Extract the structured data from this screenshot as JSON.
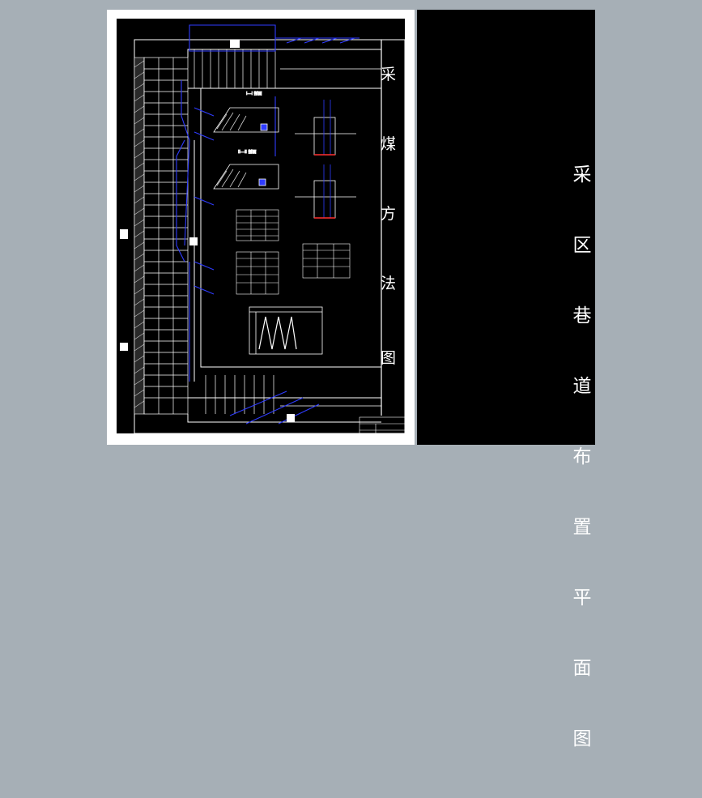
{
  "viewer": {
    "background": "#a6afb6"
  },
  "drawing": {
    "frame_color": "#ffffff",
    "line_color": "#ffffff",
    "annotation_color": "#2f3cff",
    "marker_color": "#ff3030",
    "side_title_chars": [
      "采",
      "煤",
      "方",
      "法",
      "图"
    ]
  },
  "title_panel": {
    "title_chars": [
      "采",
      "区",
      "巷",
      "道",
      "布",
      "置",
      "平",
      "面",
      "图"
    ]
  }
}
